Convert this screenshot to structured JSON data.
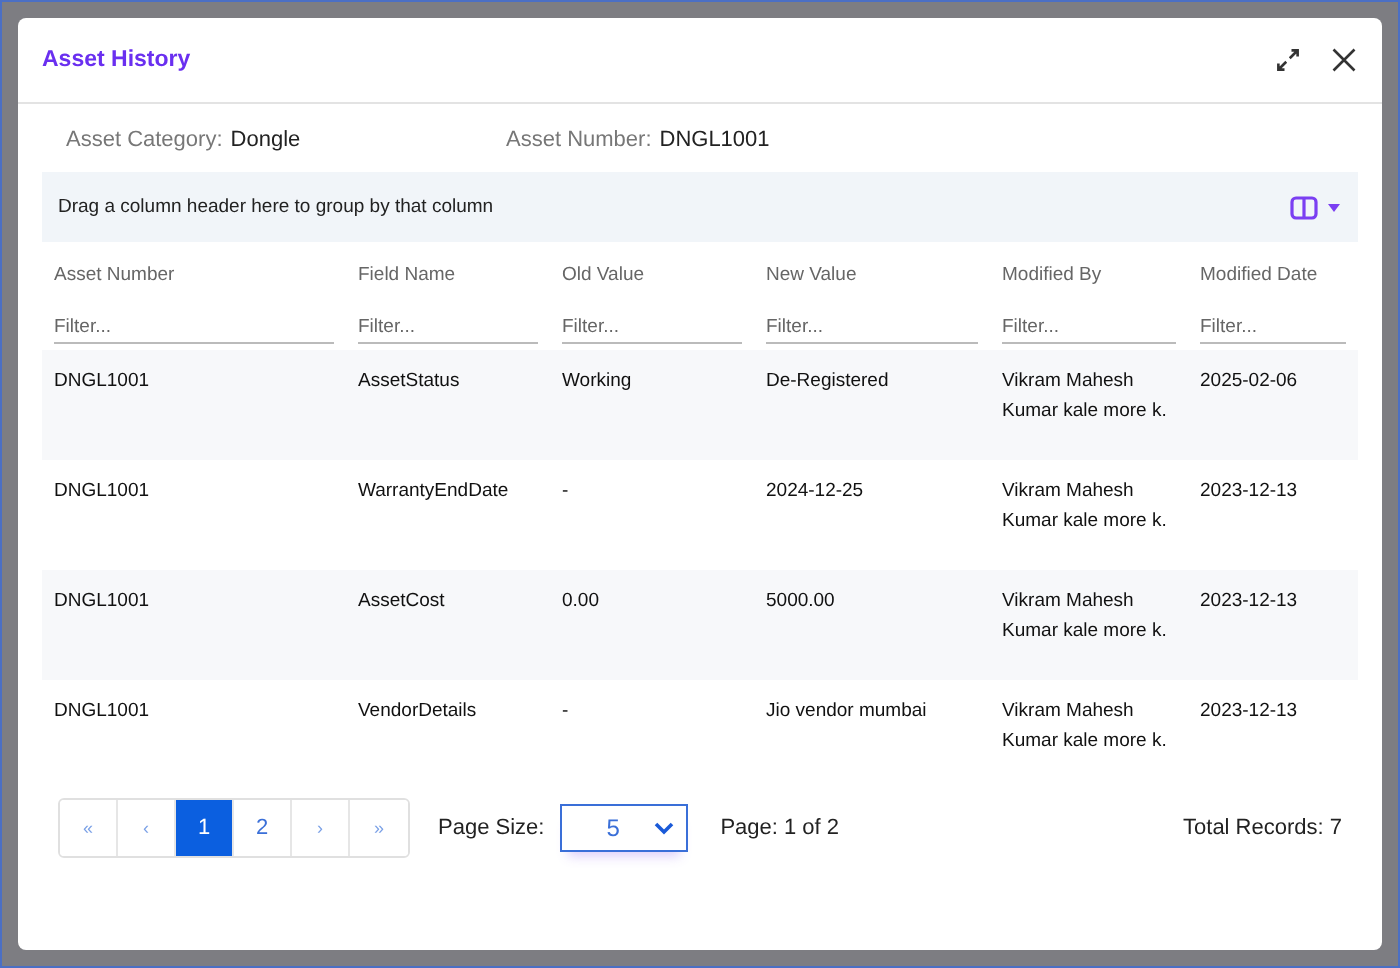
{
  "dialog": {
    "title": "Asset History"
  },
  "info": [
    {
      "label": "Asset Category:",
      "value": "Dongle"
    },
    {
      "label": "Asset Number:",
      "value": "DNGL1001"
    }
  ],
  "group_panel": {
    "text": "Drag a column header here to group by that column"
  },
  "table": {
    "columns": [
      {
        "label": "Asset Number",
        "filter_placeholder": "Filter..."
      },
      {
        "label": "Field Name",
        "filter_placeholder": "Filter..."
      },
      {
        "label": "Old Value",
        "filter_placeholder": "Filter..."
      },
      {
        "label": "New Value",
        "filter_placeholder": "Filter..."
      },
      {
        "label": "Modified By",
        "filter_placeholder": "Filter..."
      },
      {
        "label": "Modified Date",
        "filter_placeholder": "Filter..."
      }
    ],
    "rows": [
      [
        "DNGL1001",
        "AssetStatus",
        "Working",
        "De-Registered",
        "Vikram Mahesh Kumar kale more k.",
        "2025-02-06"
      ],
      [
        "DNGL1001",
        "WarrantyEndDate",
        "-",
        "2024-12-25",
        "Vikram Mahesh Kumar kale more k.",
        "2023-12-13"
      ],
      [
        "DNGL1001",
        "AssetCost",
        "0.00",
        "5000.00",
        "Vikram Mahesh Kumar kale more k.",
        "2023-12-13"
      ],
      [
        "DNGL1001",
        "VendorDetails",
        "-",
        "Jio vendor mumbai",
        "Vikram Mahesh Kumar kale more k.",
        "2023-12-13"
      ]
    ]
  },
  "pager": {
    "buttons": [
      {
        "label": "«",
        "kind": "nav",
        "selected": false
      },
      {
        "label": "‹",
        "kind": "nav",
        "selected": false
      },
      {
        "label": "1",
        "kind": "page",
        "selected": true
      },
      {
        "label": "2",
        "kind": "page",
        "selected": false
      },
      {
        "label": "›",
        "kind": "nav",
        "selected": false
      },
      {
        "label": "»",
        "kind": "nav",
        "selected": false
      }
    ],
    "page_size_label": "Page Size:",
    "page_size": "5",
    "page_info": "Page: 1 of 2",
    "total": "Total Records: 7"
  }
}
